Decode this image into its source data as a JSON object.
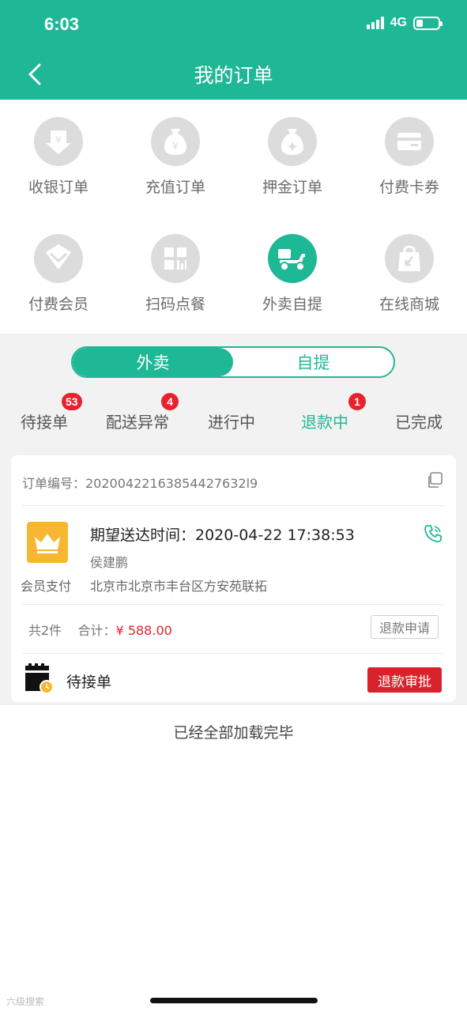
{
  "status_bar": {
    "time": "6:03",
    "network": "4G",
    "battery_level": 0.3
  },
  "header": {
    "title": "我的订单"
  },
  "grid": [
    {
      "label": "收银订单",
      "icon": "cashier-icon"
    },
    {
      "label": "充值订单",
      "icon": "recharge-icon"
    },
    {
      "label": "押金订单",
      "icon": "deposit-icon"
    },
    {
      "label": "付费卡券",
      "icon": "card-coupon-icon"
    },
    {
      "label": "付费会员",
      "icon": "member-icon"
    },
    {
      "label": "扫码点餐",
      "icon": "scan-order-icon"
    },
    {
      "label": "外卖自提",
      "icon": "delivery-icon",
      "active": true
    },
    {
      "label": "在线商城",
      "icon": "online-mall-icon"
    }
  ],
  "toggle": {
    "options": [
      "外卖",
      "自提"
    ],
    "selected": "外卖"
  },
  "tabs": [
    {
      "label": "待接单",
      "badge": "53"
    },
    {
      "label": "配送异常",
      "badge": "4"
    },
    {
      "label": "进行中"
    },
    {
      "label": "退款中",
      "badge": "1",
      "active": true
    },
    {
      "label": "已完成"
    }
  ],
  "order": {
    "order_no": "订单编号：20200422163854427632l9",
    "expected_time": "期望送达时间：2020-04-22 17:38:53",
    "customer": "侯建鹏",
    "payment": "会员支付",
    "address": "北京市北京市丰台区方安苑联拓",
    "summary_count": "共2件",
    "summary_total_label": "合计：",
    "summary_total": "¥ 588.00",
    "refund_request_btn": "退款申请",
    "status": "待接单",
    "approve_btn": "退款审批"
  },
  "footer_msg": "已经全部加载完毕",
  "watermark": "六级搜索",
  "colors": {
    "brand": "#1fb896",
    "danger": "#d9232c",
    "member": "#f7b733"
  }
}
